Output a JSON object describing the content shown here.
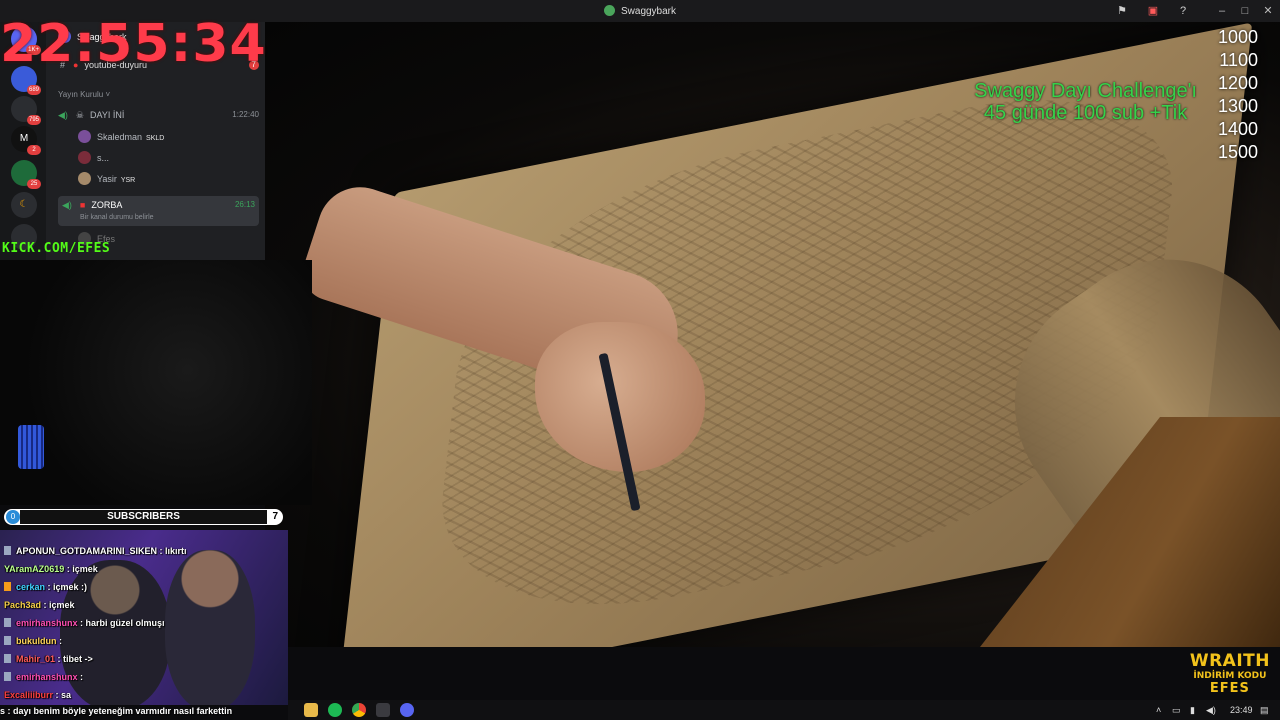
{
  "window": {
    "title": "Swaggybark"
  },
  "overlay": {
    "clock": "22:55:34",
    "challenge_line1": "Swaggy Dayı Challenge'ı",
    "challenge_line2": "45 günde 100 sub +Tik",
    "goals": [
      "1000",
      "1100",
      "1200",
      "1300",
      "1400",
      "1500"
    ],
    "kick": "KICK.COM/EFES",
    "brand_name": "WRAITH",
    "brand_sub": "İNDİRİM KODU",
    "brand_code": "EFES"
  },
  "discord": {
    "server_name": "Swaggybark",
    "channel_announcement": "youtube-duyuru",
    "channel_badge": "7",
    "category": "Yayın Kurulu",
    "voice_channel_1": {
      "name": "DAYI İNİ",
      "time": "1:22:40"
    },
    "members": [
      {
        "name": "Skaledman",
        "tag": "SKLD"
      },
      {
        "name": "s...",
        "tag": ""
      },
      {
        "name": "Yasir",
        "tag": "YSR"
      }
    ],
    "voice_channel_2": {
      "name": "ZORBA",
      "time": "26:13",
      "status": "Bir kanal durumu belirle"
    },
    "next_member": "Efes",
    "guild_badges": [
      "1K+",
      "689",
      "795",
      "2",
      "25"
    ]
  },
  "subscribers": {
    "label": "SUBSCRIBERS",
    "left": "0",
    "right": "7"
  },
  "chat": [
    {
      "user": "APONUN_GOTDAMARINI_SIKEN",
      "msg": "lıkırtı",
      "color": "#ffffff"
    },
    {
      "user": "YAramAZ0619",
      "msg": "içmek",
      "color": "#b9ff8c"
    },
    {
      "user": "cerkan",
      "msg": "içmek :)",
      "color": "#3fd2ff"
    },
    {
      "user": "Pach3ad",
      "msg": "içmek",
      "color": "#f7d04a"
    },
    {
      "user": "emirhanshunx",
      "msg": "harbi güzel olmuşı",
      "color": "#ff4fb3"
    },
    {
      "user": "bukuldun",
      "msg": "",
      "color": "#ffd45a"
    },
    {
      "user": "Mahir_01",
      "msg": "tibet ->",
      "color": "#ff5a5a"
    },
    {
      "user": "emirhanshunx",
      "msg": "",
      "color": "#ff4fb3"
    },
    {
      "user": "Excaliiiburr",
      "msg": "sa",
      "color": "#ff4040"
    }
  ],
  "last_message": "s : dayı benim böyle yeteneğim varmıdır nasıl farkettin",
  "taskbar": {
    "time": "23:49"
  }
}
